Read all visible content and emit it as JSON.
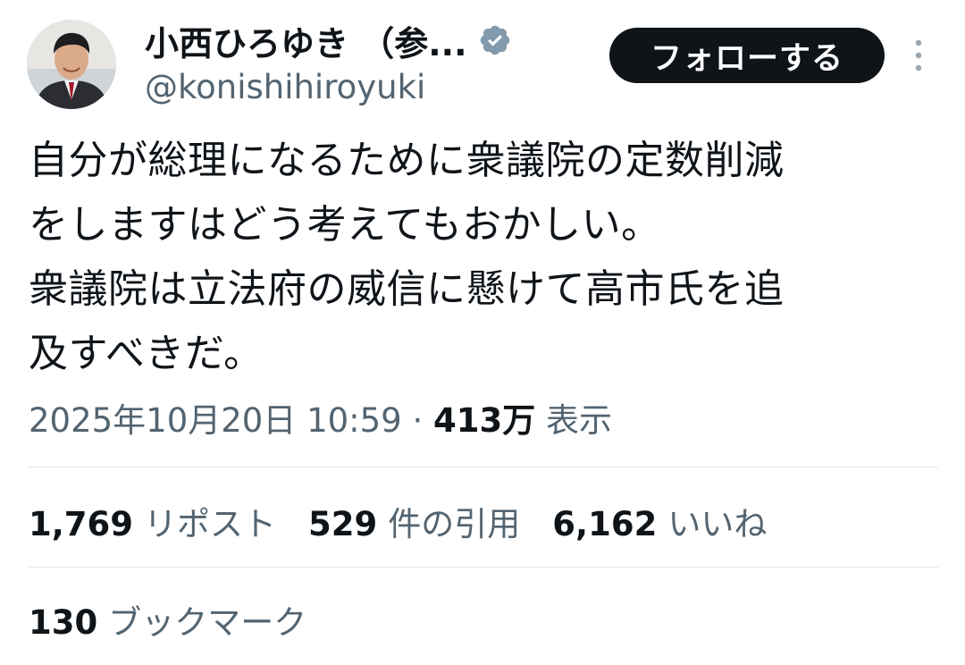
{
  "author": {
    "display_name": "小西ひろゆき （参...",
    "handle": "@konishihiroyuki",
    "verified_icon": "verified-badge-icon"
  },
  "header": {
    "follow_label": "フォローする",
    "more_icon": "more-vertical-icon"
  },
  "tweet": {
    "lines": [
      "自分が総理になるために衆議院の定数削減",
      "をしますはどう考えてもおかしい。",
      "衆議院は立法府の威信に懸けて高市氏を追",
      "及すべきだ。"
    ],
    "timestamp": "2025年10月20日 10:59",
    "separator": "·",
    "views_count": "413万",
    "views_label": "表示"
  },
  "stats": {
    "reposts_count": "1,769",
    "reposts_label": "リポスト",
    "quotes_count": "529",
    "quotes_label": "件の引用",
    "likes_count": "6,162",
    "likes_label": "いいね",
    "bookmarks_count": "130",
    "bookmarks_label": "ブックマーク"
  },
  "colors": {
    "primary_text": "#0f1419",
    "secondary_text": "#536471",
    "follow_button_bg": "#0f1419",
    "verified_badge": "#829aab",
    "divider": "#e1e6ea"
  }
}
